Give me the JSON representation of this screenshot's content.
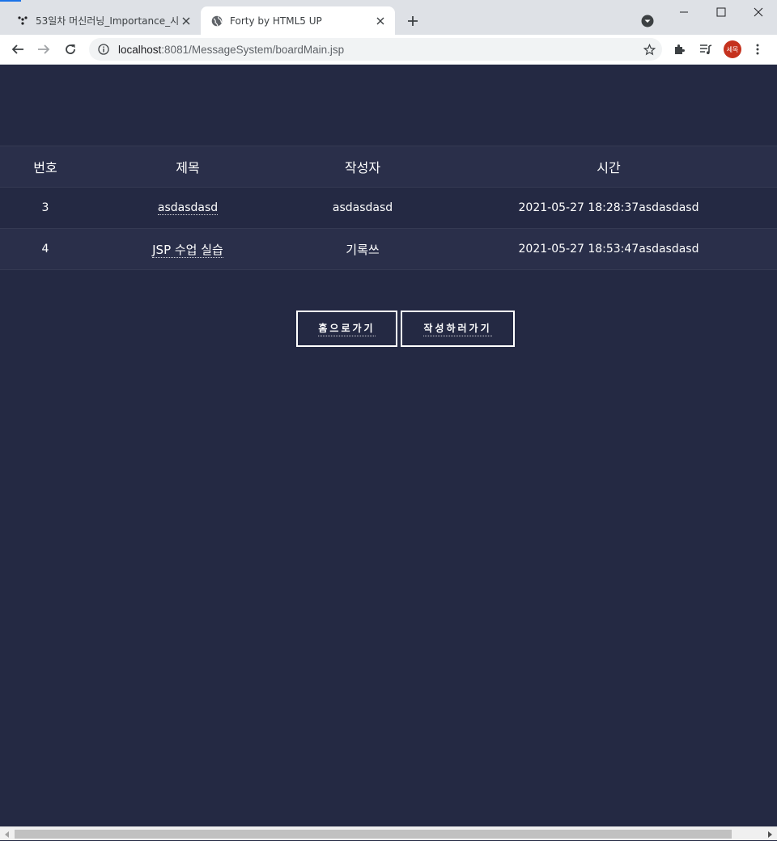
{
  "browser": {
    "tabs": [
      {
        "title": "53일차 머신러닝_Importance_시",
        "active": false,
        "icon": "notion-icon"
      },
      {
        "title": "Forty by HTML5 UP",
        "active": true,
        "icon": "globe-icon"
      }
    ],
    "url_host": "localhost",
    "url_rest": ":8081/MessageSystem/boardMain.jsp",
    "profile_initials": "세목"
  },
  "board": {
    "columns": [
      "번호",
      "제목",
      "작성자",
      "시간"
    ],
    "rows": [
      {
        "no": "3",
        "title": "asdasdasd",
        "writer": "asdasdasd",
        "time": "2021-05-27 18:28:37asdasdasd"
      },
      {
        "no": "4",
        "title": "JSP 수업 실습",
        "writer": "기록쓰",
        "time": "2021-05-27 18:53:47asdasdasd"
      }
    ]
  },
  "buttons": {
    "home": "홈으로가기",
    "write": "작성하러가기"
  },
  "colors": {
    "page_bg": "#242943",
    "row_alt_bg": "#2a2f4a",
    "text": "#ffffff"
  }
}
